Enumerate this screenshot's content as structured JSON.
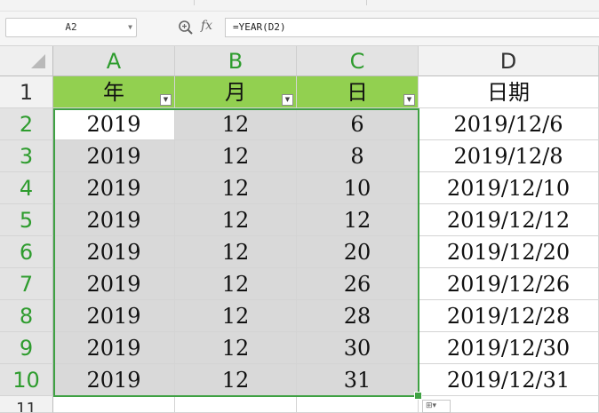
{
  "name_box": {
    "value": "A2"
  },
  "formula_bar": {
    "fx_label": "fx",
    "formula": "=YEAR(D2)"
  },
  "sheet": {
    "columns": [
      "A",
      "B",
      "C",
      "D"
    ],
    "header_row_number": "1",
    "header": [
      "年",
      "月",
      "日",
      "日期"
    ],
    "rows": [
      {
        "num": "2",
        "cells": [
          "2019",
          "12",
          "6",
          "2019/12/6"
        ]
      },
      {
        "num": "3",
        "cells": [
          "2019",
          "12",
          "8",
          "2019/12/8"
        ]
      },
      {
        "num": "4",
        "cells": [
          "2019",
          "12",
          "10",
          "2019/12/10"
        ]
      },
      {
        "num": "5",
        "cells": [
          "2019",
          "12",
          "12",
          "2019/12/12"
        ]
      },
      {
        "num": "6",
        "cells": [
          "2019",
          "12",
          "20",
          "2019/12/20"
        ]
      },
      {
        "num": "7",
        "cells": [
          "2019",
          "12",
          "26",
          "2019/12/26"
        ]
      },
      {
        "num": "8",
        "cells": [
          "2019",
          "12",
          "28",
          "2019/12/28"
        ]
      },
      {
        "num": "9",
        "cells": [
          "2019",
          "12",
          "30",
          "2019/12/30"
        ]
      },
      {
        "num": "10",
        "cells": [
          "2019",
          "12",
          "31",
          "2019/12/31"
        ]
      }
    ],
    "next_row_number": "11",
    "selection": "A2:C10",
    "colors": {
      "header_fill": "#92d050",
      "selection_border": "#3fa143",
      "selected_fill": "#d9d9d9",
      "header_text": "#2e9c2e"
    }
  }
}
